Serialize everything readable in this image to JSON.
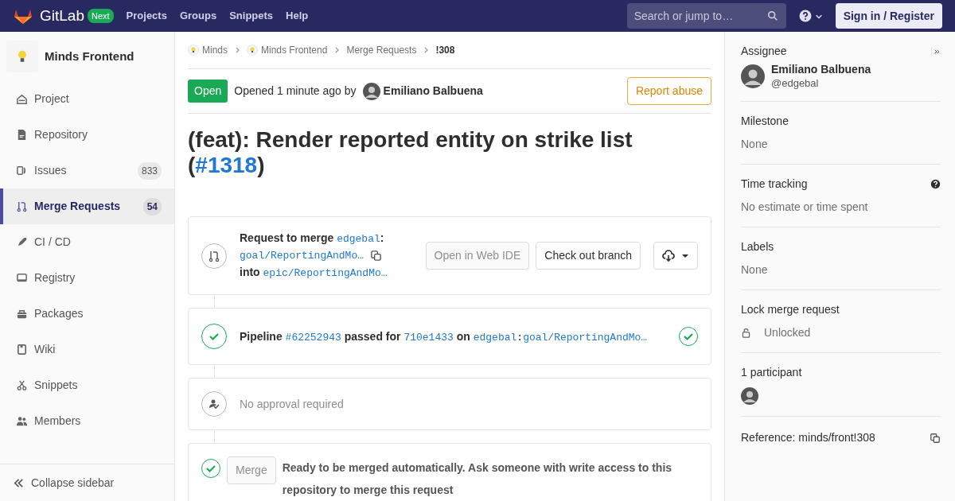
{
  "navbar": {
    "brand": "GitLab",
    "badge": "Next",
    "links": [
      "Projects",
      "Groups",
      "Snippets",
      "Help"
    ],
    "search": {
      "placeholder": "Search or jump to…"
    },
    "sign_in": "Sign in / Register"
  },
  "sidebar": {
    "project": "Minds Frontend",
    "items": [
      {
        "label": "Project",
        "selected": false
      },
      {
        "label": "Repository",
        "selected": false
      },
      {
        "label": "Issues",
        "count": "833",
        "selected": false
      },
      {
        "label": "Merge Requests",
        "count": "54",
        "selected": true
      },
      {
        "label": "CI / CD",
        "selected": false
      },
      {
        "label": "Registry",
        "selected": false
      },
      {
        "label": "Packages",
        "selected": false
      },
      {
        "label": "Wiki",
        "selected": false
      },
      {
        "label": "Snippets",
        "selected": false
      },
      {
        "label": "Members",
        "selected": false
      }
    ],
    "collapse": "Collapse sidebar"
  },
  "breadcrumbs": [
    {
      "label": "Minds",
      "kind": "group"
    },
    {
      "label": "Minds Frontend",
      "kind": "group"
    },
    {
      "label": "Merge Requests",
      "kind": "link"
    },
    {
      "label": "!308",
      "kind": "current"
    }
  ],
  "header": {
    "status": "Open",
    "opened": "Opened 1 minute ago by",
    "author": "Emiliano Balbuena",
    "report": "Report abuse"
  },
  "title": {
    "text": "(feat): Render reported entity on strike list (",
    "link": "#1318",
    "end": ")"
  },
  "merge_info": {
    "label": "Request to merge",
    "source_ns": "edgebal",
    "sep": ":",
    "source_branch": "goal/ReportingAndMo…",
    "into": "into",
    "target_branch": "epic/ReportingAndMo…",
    "buttons": [
      {
        "label": "Open in Web IDE",
        "disabled": true
      },
      {
        "label": "Check out branch",
        "disabled": false
      }
    ]
  },
  "pipeline": {
    "word": "Pipeline",
    "id": "#62252943",
    "passed": "passed for",
    "commit": "710e1433",
    "on": "on",
    "ns": "edgebal",
    "sep": ":",
    "branch": "goal/ReportingAndMo…"
  },
  "approval": {
    "text": "No approval required"
  },
  "merge": {
    "button": {
      "label": "Merge",
      "disabled": true
    },
    "text": "Ready to be merged automatically. Ask someone with write access to this repository to merge this request"
  },
  "right": {
    "assignee_label": "Assignee",
    "assignee_name": "Emiliano Balbuena",
    "assignee_user": "@edgebal",
    "blocks": [
      {
        "title": "Milestone",
        "value": "None"
      },
      {
        "title": "Time tracking",
        "value": "No estimate or time spent",
        "help": true
      },
      {
        "title": "Labels",
        "value": "None"
      },
      {
        "title": "Lock merge request",
        "value": "Unlocked",
        "locked": false
      }
    ],
    "participants": "1 participant",
    "reference": "Reference: minds/front!308"
  }
}
